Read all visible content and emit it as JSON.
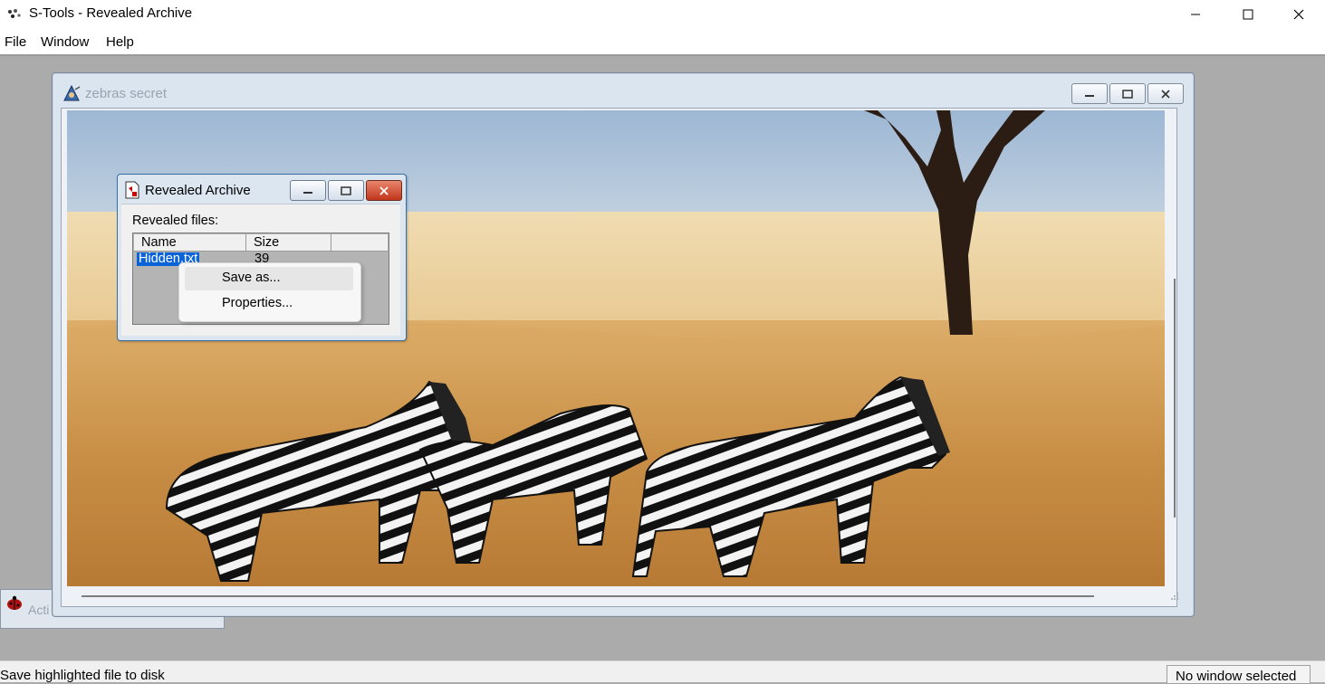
{
  "app": {
    "title": "S-Tools - Revealed Archive",
    "icon": "stools-app-icon"
  },
  "window_controls": [
    "minimize-icon",
    "maximize-icon",
    "close-icon"
  ],
  "menu": {
    "items": [
      {
        "label": "File"
      },
      {
        "label": "Window"
      },
      {
        "label": "Help"
      }
    ]
  },
  "iconified_window": {
    "label": "Acti",
    "icon": "ladybug-icon"
  },
  "image_window": {
    "title": "zebras secret",
    "icon": "wizard-icon",
    "image": "zebras-savanna-image"
  },
  "revealed_dialog": {
    "title": "Revealed Archive",
    "label": "Revealed files:",
    "columns": [
      "Name",
      "Size"
    ],
    "files": [
      {
        "name": "Hidden.txt",
        "size": "39",
        "selected": true
      }
    ]
  },
  "context_menu": {
    "items": [
      {
        "label": "Save as...",
        "hover": true
      },
      {
        "label": "Properties..."
      }
    ]
  },
  "status": {
    "left": "Save highlighted file to disk",
    "right": "No window selected"
  },
  "colors": {
    "mdi_background": "#ababab",
    "selection": "#0a64d8",
    "close_button": "#c2351b"
  }
}
